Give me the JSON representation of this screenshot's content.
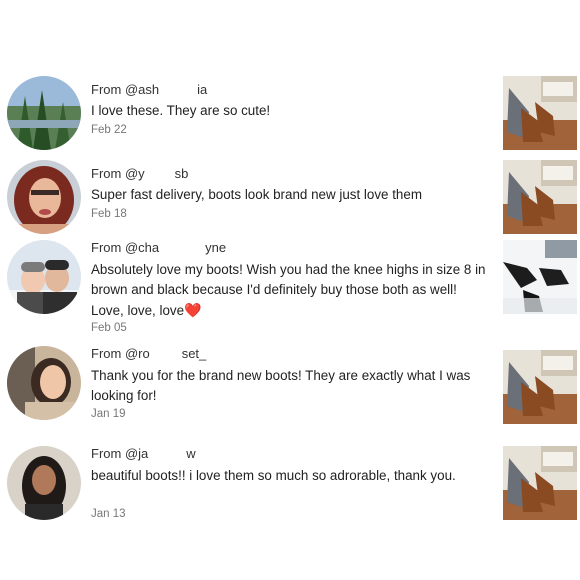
{
  "comments": [
    {
      "from": "From @ash",
      "from_tail": "ia",
      "text": "I love these. They are so cute!",
      "date": "Feb 22",
      "avatar_icon": "avatar-forest",
      "thumb_icon": "boots-photo"
    },
    {
      "from": "From @y",
      "from_tail": "sb",
      "text": "Super fast delivery, boots look brand new just love them",
      "date": "Feb 18",
      "avatar_icon": "avatar-woman-red",
      "thumb_icon": "boots-photo"
    },
    {
      "from": "From @cha",
      "from_tail": "yne",
      "text": "Absolutely love my boots! Wish you had the knee highs in size 8 in brown and black because I'd definitely buy those both as well! Love, love, love",
      "heart": "❤️",
      "date": "Feb 05",
      "avatar_icon": "avatar-couple-snow",
      "thumb_icon": "boots-snow-photo"
    },
    {
      "from": "From @ro",
      "from_tail": "set_",
      "text": "Thank you for the brand new boots! They are exactly what I was looking for!",
      "date": "Jan 19",
      "avatar_icon": "avatar-woman-selfie",
      "thumb_icon": "boots-photo"
    },
    {
      "from": "From @ja",
      "from_tail": "w",
      "text": "beautiful boots!! i love them so much so adrorable, thank you.",
      "date": "Jan 13",
      "avatar_icon": "avatar-woman-dark-hair",
      "thumb_icon": "boots-photo"
    }
  ]
}
